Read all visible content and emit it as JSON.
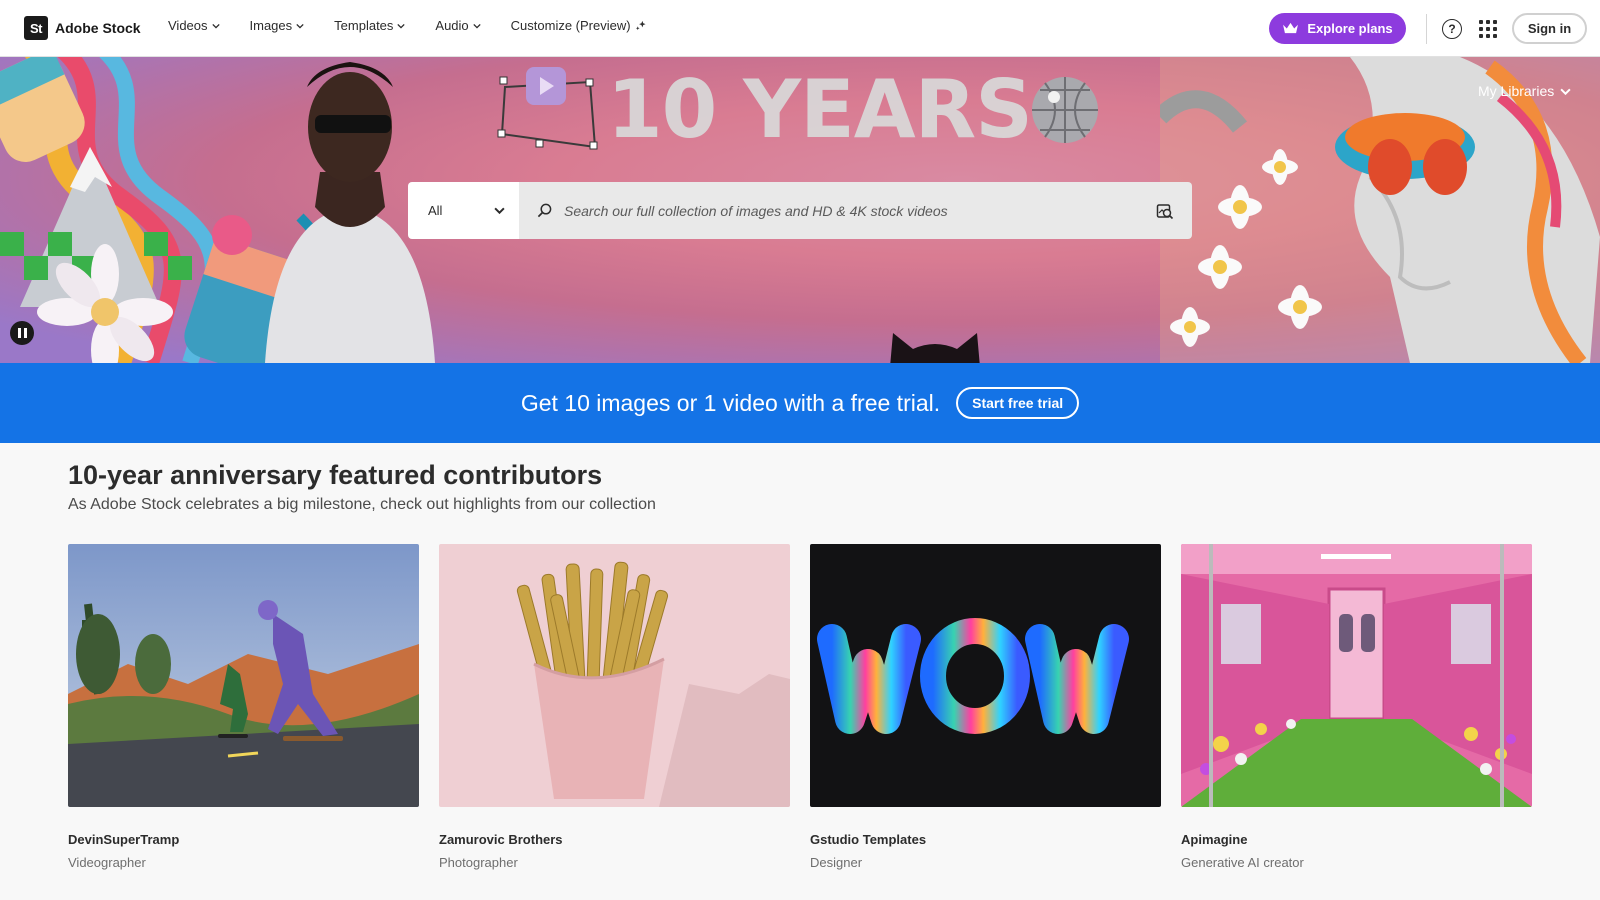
{
  "brand": {
    "logo_text": "St",
    "name": "Adobe Stock"
  },
  "nav": {
    "items": [
      {
        "label": "Videos"
      },
      {
        "label": "Images"
      },
      {
        "label": "Templates"
      },
      {
        "label": "Audio"
      },
      {
        "label": "Customize (Preview)"
      }
    ],
    "explore_label": "Explore plans",
    "help_icon": "help-icon",
    "apps_icon": "apps-grid-icon",
    "signin_label": "Sign in"
  },
  "hero": {
    "title": "10 YEARS",
    "my_libraries_label": "My Libraries",
    "search": {
      "category_value": "All",
      "placeholder": "Search our full collection of images and HD & 4K stock videos"
    }
  },
  "promo": {
    "text": "Get 10 images or 1 video with a free trial.",
    "button_label": "Start free trial"
  },
  "contributors": {
    "title": "10-year anniversary featured contributors",
    "subtitle": "As Adobe Stock celebrates a big milestone, check out highlights from our collection",
    "cards": [
      {
        "name": "DevinSuperTramp",
        "role": "Videographer"
      },
      {
        "name": "Zamurovic Brothers",
        "role": "Photographer"
      },
      {
        "name": "Gstudio Templates",
        "role": "Designer"
      },
      {
        "name": "Apimagine",
        "role": "Generative AI creator"
      }
    ]
  },
  "colors": {
    "explore_plans": "#8d3bde",
    "promo_banner": "#1473e6",
    "hero_pink": "#d98aa2"
  }
}
